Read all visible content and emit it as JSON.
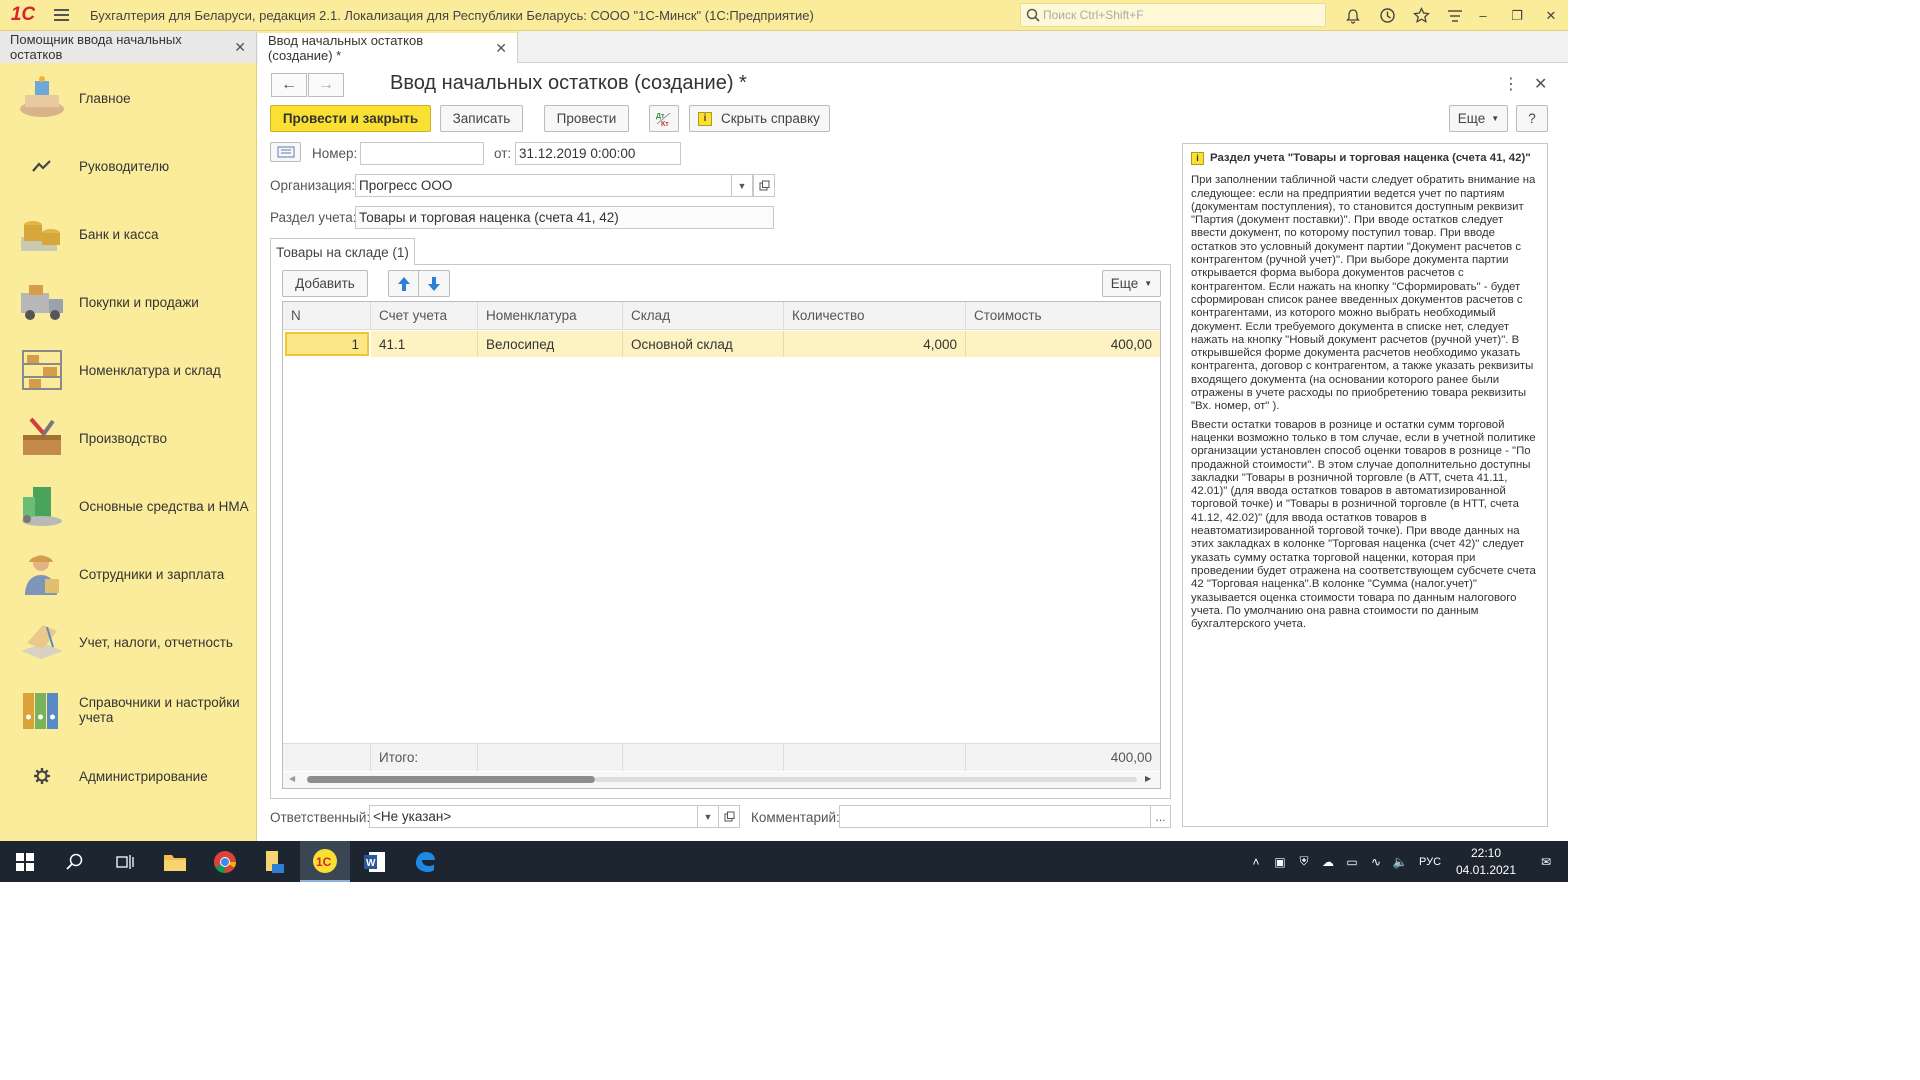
{
  "titlebar": {
    "app_title": "Бухгалтерия для Беларуси, редакция 2.1. Локализация для Республики Беларусь: СООО \"1С-Минск\"  (1С:Предприятие)",
    "logo_text": "1С",
    "search_placeholder": "Поиск Ctrl+Shift+F"
  },
  "tabs": [
    {
      "label": "Помощник ввода начальных остатков"
    },
    {
      "label": "Ввод начальных остатков (создание) *"
    }
  ],
  "sidebar": {
    "items": [
      {
        "label": "Главное",
        "icon": "desk-icon"
      },
      {
        "label": "Руководителю",
        "icon": "trend-icon"
      },
      {
        "label": "Банк и касса",
        "icon": "coins-icon"
      },
      {
        "label": "Покупки и продажи",
        "icon": "truck-icon"
      },
      {
        "label": "Номенклатура и склад",
        "icon": "shelves-icon"
      },
      {
        "label": "Производство",
        "icon": "toolbox-icon"
      },
      {
        "label": "Основные средства и НМА",
        "icon": "building-icon"
      },
      {
        "label": "Сотрудники и зарплата",
        "icon": "worker-icon"
      },
      {
        "label": "Учет, налоги, отчетность",
        "icon": "ledger-icon"
      },
      {
        "label": "Справочники и настройки учета",
        "icon": "binders-icon"
      },
      {
        "label": "Администрирование",
        "icon": "gear-icon"
      }
    ]
  },
  "form": {
    "title": "Ввод начальных остатков (создание) *",
    "buttons": {
      "post_close": "Провести и закрыть",
      "save": "Записать",
      "post": "Провести",
      "dtkt": "Дт Кт",
      "hide_help": "Скрыть справку",
      "more": "Еще",
      "help": "?"
    },
    "number_label": "Номер:",
    "number_value": "",
    "date_label": "от:",
    "date_value": "31.12.2019  0:00:00",
    "org_label": "Организация:",
    "org_value": "Прогресс ООО",
    "section_label": "Раздел учета:",
    "section_value": "Товары и торговая наценка (счета 41, 42)",
    "tab_label": "Товары на складе (1)",
    "table_buttons": {
      "add": "Добавить",
      "more": "Еще"
    },
    "table": {
      "columns": [
        "N",
        "Счет учета",
        "Номенклатура",
        "Склад",
        "Количество",
        "Стоимость"
      ],
      "rows": [
        {
          "n": "1",
          "account": "41.1",
          "item": "Велосипед",
          "warehouse": "Основной склад",
          "qty": "4,000",
          "cost": "400,00"
        }
      ],
      "footer_label": "Итого:",
      "footer_total": "400,00"
    },
    "responsible_label": "Ответственный:",
    "responsible_value": "<Не указан>",
    "comment_label": "Комментарий:",
    "comment_value": "",
    "ellipsis": "..."
  },
  "help": {
    "title": "Раздел учета \"Товары и торговая наценка (счета 41, 42)\"",
    "p1": "При заполнении табличной части следует обратить внимание на следующее: если на предприятии ведется учет по партиям (документам поступления), то становится доступным реквизит \"Партия (документ поставки)\". При вводе остатков следует ввести документ, по которому поступил товар. При вводе остатков это условный документ партии \"Документ расчетов с контрагентом (ручной учет)\". При выборе документа партии открывается форма выбора документов расчетов с контрагентом. Если нажать на кнопку \"Сформировать\" - будет сформирован список ранее введенных документов расчетов с контрагентами, из которого можно выбрать необходимый документ. Если требуемого документа в списке нет, следует нажать на кнопку \"Новый документ расчетов (ручной учет)\". В открывшейся форме документа расчетов необходимо указать контрагента, договор с контрагентом, а также указать реквизиты входящего документа (на основании которого ранее были отражены в учете расходы по приобретению товара реквизиты \"Вх. номер, от\" ).",
    "p2": "Ввести остатки товаров в рознице и остатки сумм торговой наценки возможно только в том случае, если в учетной политике организации установлен способ оценки товаров в рознице - \"По продажной стоимости\". В этом случае дополнительно доступны закладки \"Товары в розничной торговле (в АТТ, счета 41.11, 42.01)\" (для ввода остатков товаров в автоматизированной торговой точке) и \"Товары в розничной торговле (в НТТ, счета 41.12, 42.02)\" (для ввода остатков товаров в неавтоматизированной торговой точке). При вводе данных на этих закладках в колонке \"Торговая наценка (счет 42)\" следует указать сумму остатка торговой наценки, которая при проведении будет отражена на соответствующем субсчете счета 42 \"Торговая наценка\".В колонке \"Сумма (налог.учет)\" указывается оценка стоимости товара по данным налогового учета. По умолчанию она равна стоимости по данным бухгалтерского учета."
  },
  "taskbar": {
    "lang": "РУС",
    "time": "22:10",
    "date": "04.01.2021"
  }
}
